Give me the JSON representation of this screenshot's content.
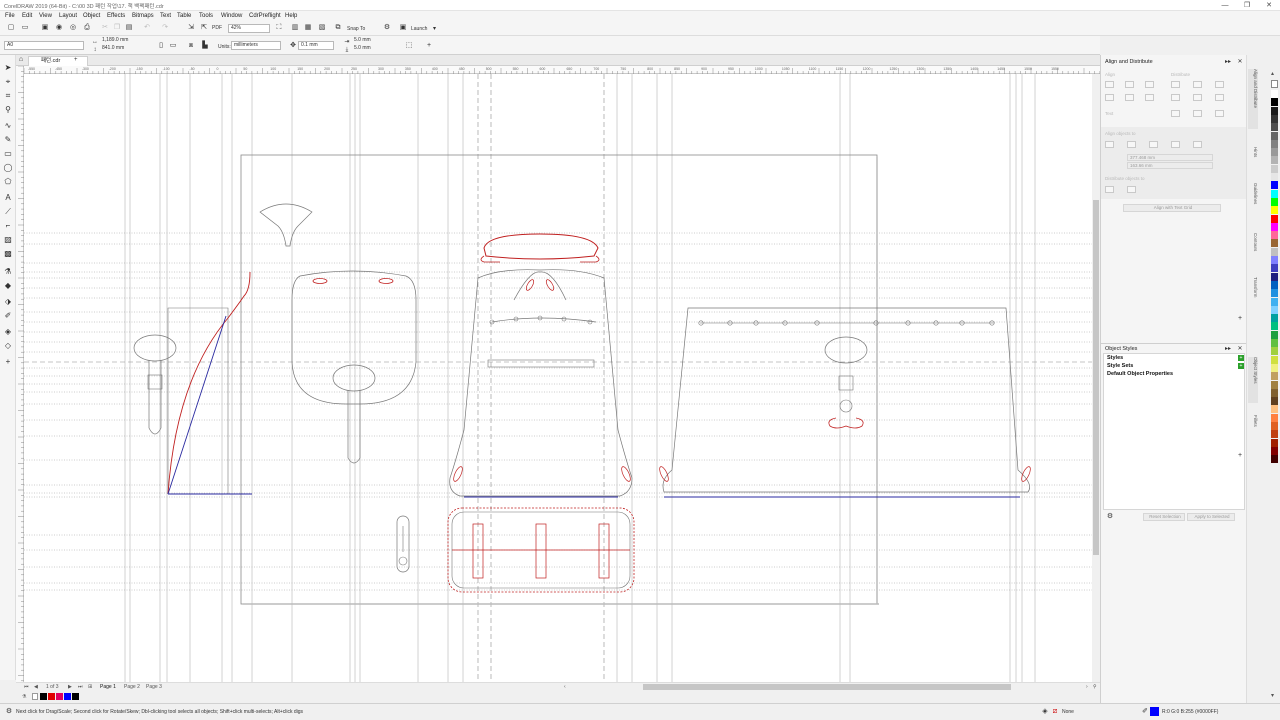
{
  "app": {
    "window_title": "CorelDRAW 2019 (64-Bit) - C:\\00 3D 패턴 작업\\17. 책 백팩패턴.cdr",
    "window_buttons": [
      "—",
      "❐",
      "✕"
    ]
  },
  "menu": [
    "File",
    "Edit",
    "View",
    "Layout",
    "Object",
    "Effects",
    "Bitmaps",
    "Text",
    "Table",
    "Tools",
    "Window",
    "CdrPreflight",
    "Help"
  ],
  "toolbar1": {
    "zoom": "42%",
    "snap_to": "Snap To",
    "launch": "Launch"
  },
  "toolbar2": {
    "page_size": "A0",
    "width": "1,189.0 mm",
    "height": "841.0 mm",
    "units_label": "Units:",
    "units": "millimeters",
    "nudge": "0.1 mm",
    "dup_x": "5.0 mm",
    "dup_y": "5.0 mm"
  },
  "document": {
    "tab_name": "패턴.cdr",
    "add_tab": "+"
  },
  "ruler": {
    "h_labels": [
      "-550",
      "-450",
      "-300",
      "-200",
      "-150",
      "-100",
      "-50",
      "0",
      "50",
      "100",
      "150",
      "200",
      "250",
      "300",
      "350",
      "400",
      "450",
      "500",
      "550",
      "600",
      "650",
      "700",
      "750",
      "800",
      "850",
      "900",
      "950",
      "1000",
      "1050",
      "1100",
      "1150",
      "1200",
      "1250",
      "1300",
      "1350",
      "1400",
      "1450",
      "1500",
      "1550"
    ],
    "unit": "millimeters"
  },
  "pages": {
    "tabs": [
      "Page 1",
      "Page 2",
      "Page 3"
    ],
    "count": "1 of 3"
  },
  "align_docker": {
    "title": "Align and Distribute",
    "align": "Align",
    "distribute": "Distribute",
    "text": "Text",
    "align_objects_to": "Align objects to",
    "x_value": "377.468 mm",
    "y_value": "163.66 mm",
    "distribute_objects_to": "Distribute objects to",
    "align_button": "Align with Text Grid"
  },
  "object_styles": {
    "title": "Object Styles",
    "items": [
      "Styles",
      "Style Sets",
      "Default Object Properties"
    ],
    "reset_button": "Reset Selection",
    "apply_button": "Apply to Selected"
  },
  "docker_tabs": [
    "Align and Distribute",
    "Hints",
    "Guidelines",
    "Contours",
    "Transform",
    "Object Styles",
    "Fillets"
  ],
  "status": {
    "hint": "Next click for Drag/Scale; Second click for Rotate/Skew; Dbl-clicking tool selects all objects; Shift+click multi-selects; Alt+click digs",
    "fill_none": "None",
    "outline": "R:0 G:0 B:255 (#0000FF)"
  },
  "palette_colors": [
    "#ffffff",
    "#000000",
    "#1a1a1a",
    "#333333",
    "#4d4d4d",
    "#666666",
    "#808080",
    "#999999",
    "#b3b3b3",
    "#cccccc",
    "#e6e6e6",
    "#0000ff",
    "#00ffff",
    "#00ff00",
    "#ffff00",
    "#ff0000",
    "#ff00ff",
    "#ff6699",
    "#996633",
    "#c0c0c0",
    "#8080ff",
    "#4040c0",
    "#202080",
    "#0060c0",
    "#2090e0",
    "#40b0f0",
    "#80d0ff",
    "#00a0a0",
    "#00c080",
    "#20a040",
    "#60c040",
    "#a0d040",
    "#d0e040",
    "#f0f080",
    "#c0a060",
    "#a08040",
    "#806030",
    "#604020",
    "#ffc080",
    "#ff8040",
    "#e06020",
    "#c04010",
    "#a02000",
    "#800000",
    "#400000"
  ],
  "colors": {
    "accent_blue": "#0000ff",
    "pattern_red": "#c02020",
    "guide_gray": "#9c9c9c"
  }
}
